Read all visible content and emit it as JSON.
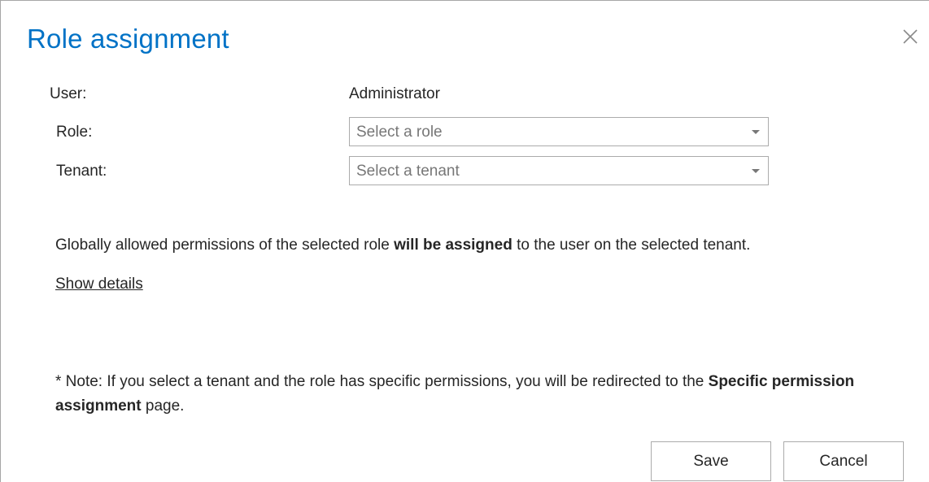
{
  "dialog": {
    "title": "Role assignment",
    "close_icon": "close-icon"
  },
  "form": {
    "user_label": "User:",
    "user_value": "Administrator",
    "role_label": "Role:",
    "role_placeholder": "Select a role",
    "tenant_label": "Tenant:",
    "tenant_placeholder": "Select a tenant"
  },
  "info": {
    "text_before": "Globally allowed permissions of the selected role ",
    "text_bold": "will be assigned",
    "text_after": " to the user on the selected tenant.",
    "show_details": "Show details"
  },
  "note": {
    "text_before": "* Note: If you select a tenant and the role has specific permissions, you will be redirected to the ",
    "text_bold": "Specific permission assignment",
    "text_after": " page."
  },
  "buttons": {
    "save": "Save",
    "cancel": "Cancel"
  },
  "colors": {
    "title": "#0072c6",
    "text": "#262626",
    "placeholder": "#777777",
    "border": "#ababab"
  }
}
